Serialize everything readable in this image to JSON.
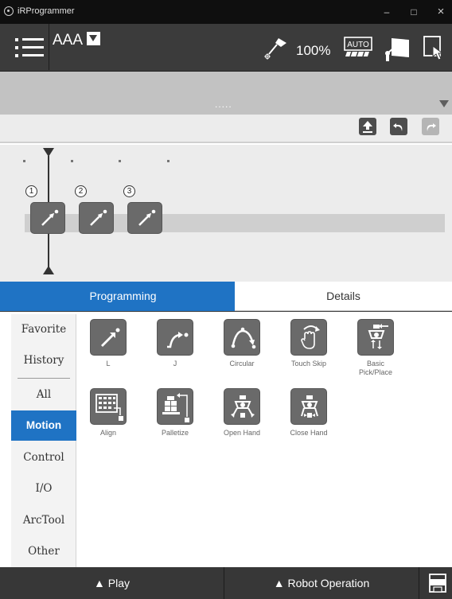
{
  "window": {
    "title": "iRProgrammer",
    "minimize": "–",
    "maximize": "□",
    "close": "×"
  },
  "header": {
    "program_name": "AAA",
    "speed": "100%"
  },
  "banner": {
    "dots": "....."
  },
  "timeline": {
    "nodes": [
      {
        "number": "1"
      },
      {
        "number": "2"
      },
      {
        "number": "3"
      }
    ]
  },
  "tabs": {
    "programming": "Programming",
    "details": "Details"
  },
  "categories": [
    "Favorite",
    "History",
    "All",
    "Motion",
    "Control",
    "I/O",
    "ArcTool",
    "Other"
  ],
  "selected_category": "Motion",
  "instructions": [
    {
      "label": "L",
      "icon": "linear-motion-icon"
    },
    {
      "label": "J",
      "icon": "joint-motion-icon"
    },
    {
      "label": "Circular",
      "icon": "circular-motion-icon"
    },
    {
      "label": "Touch Skip",
      "icon": "touch-skip-icon"
    },
    {
      "label": "Basic Pick/Place",
      "icon": "pick-place-icon"
    },
    {
      "label": "Align",
      "icon": "align-icon"
    },
    {
      "label": "Palletize",
      "icon": "palletize-icon"
    },
    {
      "label": "Open Hand",
      "icon": "open-hand-icon"
    },
    {
      "label": "Close Hand",
      "icon": "close-hand-icon"
    }
  ],
  "bottom_bar": {
    "play": "▲ Play",
    "robot_operation": "▲ Robot Operation"
  },
  "colors": {
    "accent": "#1f73c4",
    "header": "#3b3b3b",
    "button": "#6a6a6a"
  }
}
